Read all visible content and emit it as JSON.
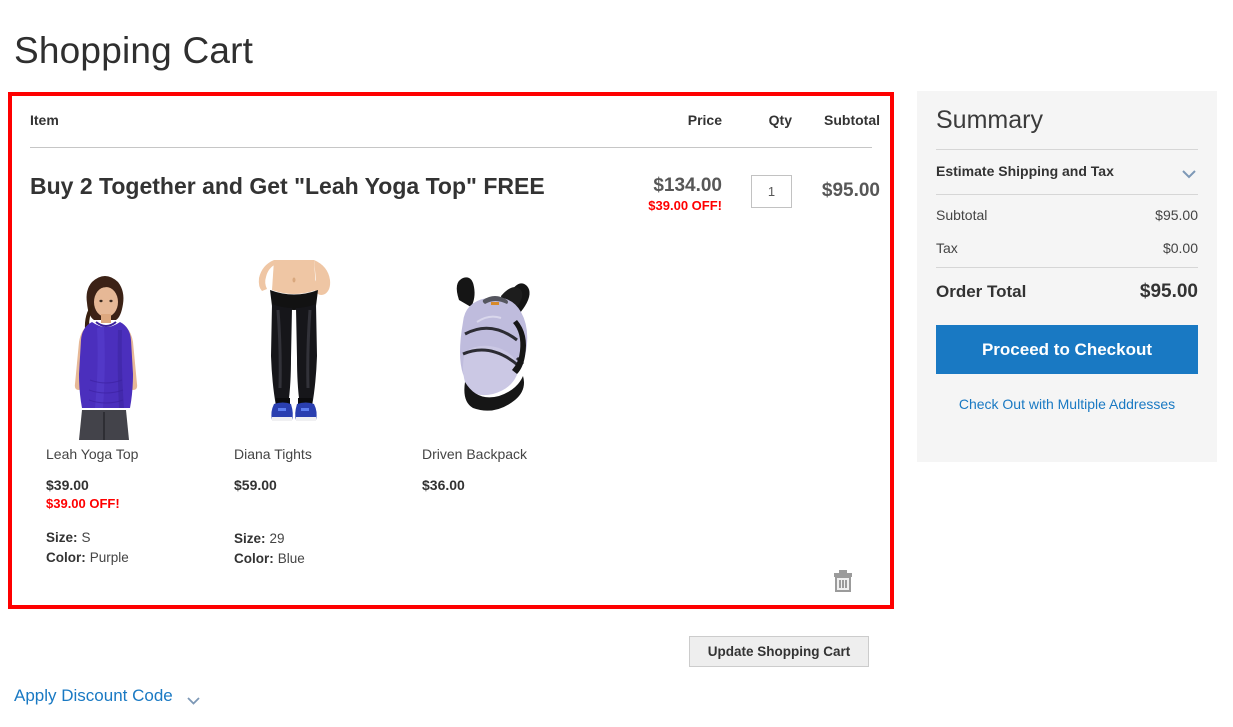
{
  "page": {
    "title": "Shopping Cart"
  },
  "cart": {
    "columns": {
      "item": "Item",
      "price": "Price",
      "qty": "Qty",
      "subtotal": "Subtotal"
    },
    "row": {
      "name": "Buy 2 Together and Get \"Leah Yoga Top\" FREE",
      "price": "$134.00",
      "price_discount": "$39.00 OFF!",
      "qty_value": "1",
      "subtotal": "$95.00",
      "remove_icon": "trash-icon",
      "plus_separator": "+",
      "products": [
        {
          "name": "Leah Yoga Top",
          "price": "$39.00",
          "discount": "$39.00 OFF!",
          "options": [
            {
              "label": "Size:",
              "value": "S"
            },
            {
              "label": "Color:",
              "value": "Purple"
            }
          ]
        },
        {
          "name": "Diana Tights",
          "price": "$59.00",
          "discount": "",
          "options": [
            {
              "label": "Size:",
              "value": "29"
            },
            {
              "label": "Color:",
              "value": "Blue"
            }
          ]
        },
        {
          "name": "Driven Backpack",
          "price": "$36.00",
          "discount": "",
          "options": []
        }
      ]
    }
  },
  "summary": {
    "title": "Summary",
    "estimate_label": "Estimate Shipping and Tax",
    "estimate_icon": "chevron-down-icon",
    "subtotal_label": "Subtotal",
    "subtotal_value": "$95.00",
    "tax_label": "Tax",
    "tax_value": "$0.00",
    "order_total_label": "Order Total",
    "order_total_value": "$95.00",
    "checkout_label": "Proceed to Checkout",
    "multi_address_label": "Check Out with Multiple Addresses"
  },
  "actions": {
    "update_cart_label": "Update Shopping Cart",
    "discount_label": "Apply Discount Code",
    "discount_icon": "chevron-down-icon"
  },
  "colors": {
    "highlight_border": "#fe0000",
    "accent_blue": "#1979c3",
    "discount_red": "#ff0000",
    "panel_bg": "#f5f5f5"
  }
}
